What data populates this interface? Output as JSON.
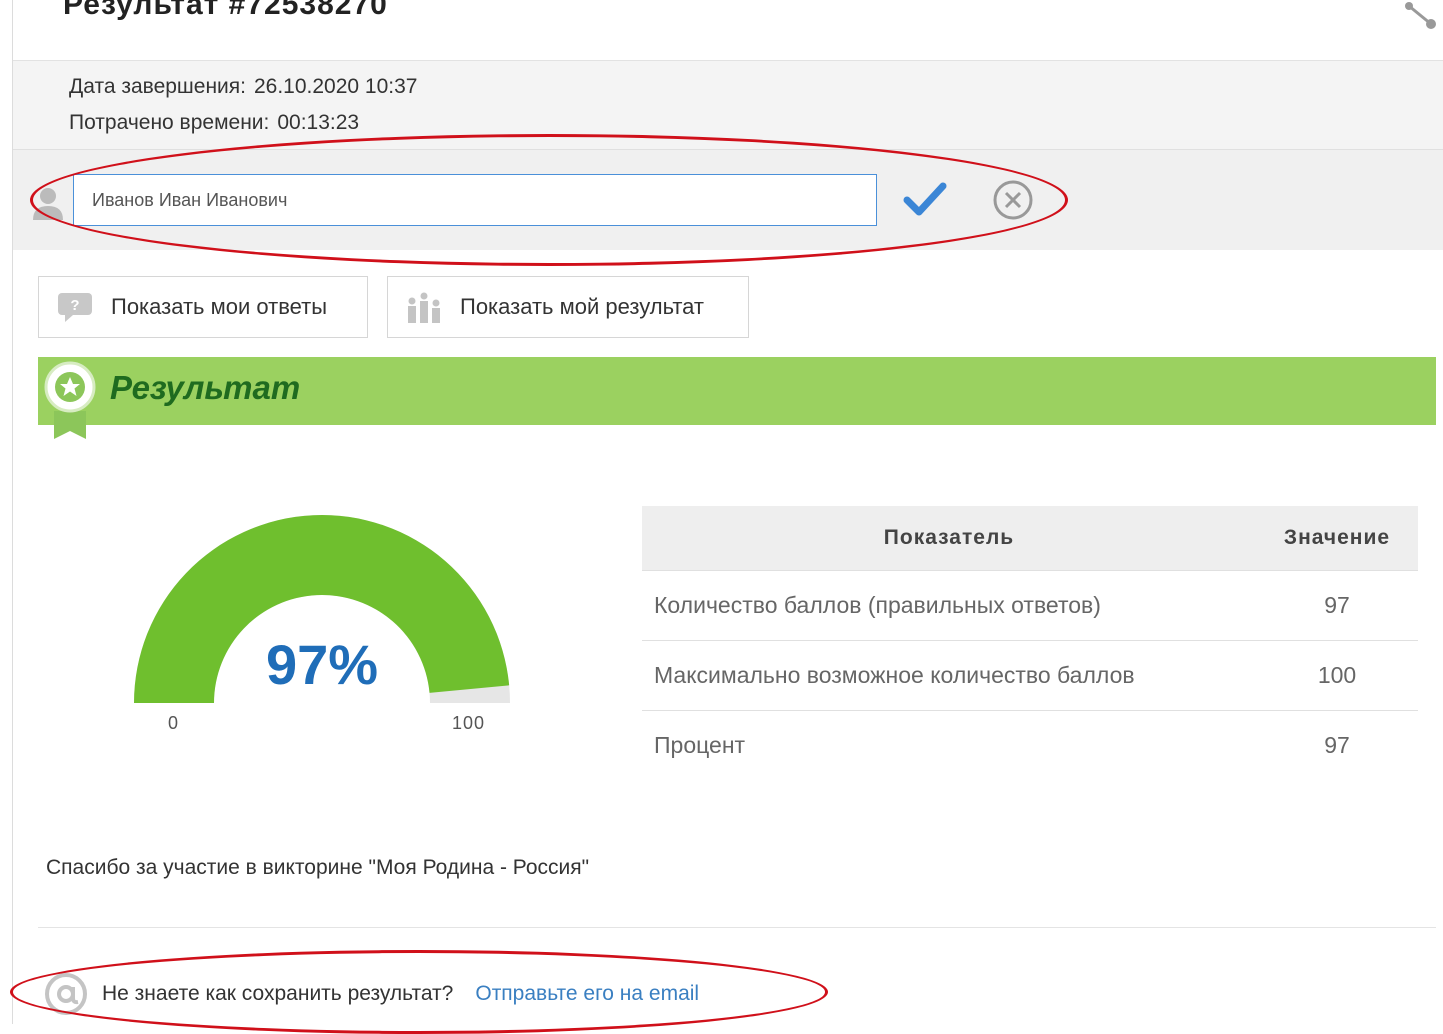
{
  "header": {
    "title": "Результат #72538270"
  },
  "meta": {
    "completion_label": "Дата завершения:",
    "completion_value": "26.10.2020 10:37",
    "time_label": "Потрачено времени:",
    "time_value": "00:13:23"
  },
  "name_field": {
    "value": "Иванов Иван Иванович"
  },
  "buttons": {
    "show_answers": "Показать мои ответы",
    "show_result": "Показать мой результат"
  },
  "result": {
    "title": "Результат",
    "percent_label": "97%",
    "percent": 97,
    "gauge_min": "0",
    "gauge_max": "100",
    "gauge_color": "#6fbf2e",
    "table": {
      "headers": [
        "Показатель",
        "Значение"
      ],
      "rows": [
        {
          "name": "Количество баллов (правильных ответов)",
          "value": "97"
        },
        {
          "name": "Максимально возможное количество баллов",
          "value": "100"
        },
        {
          "name": "Процент",
          "value": "97"
        }
      ]
    }
  },
  "thanks_text": "Спасибо за участие в викторине \"Моя Родина - Россия\"",
  "email": {
    "question": "Не знаете как сохранить результат?",
    "link": "Отправьте его на email"
  },
  "colors": {
    "accent_green": "#9bd160",
    "link_blue": "#3a7fc1",
    "annotation_red": "#d0101a"
  }
}
